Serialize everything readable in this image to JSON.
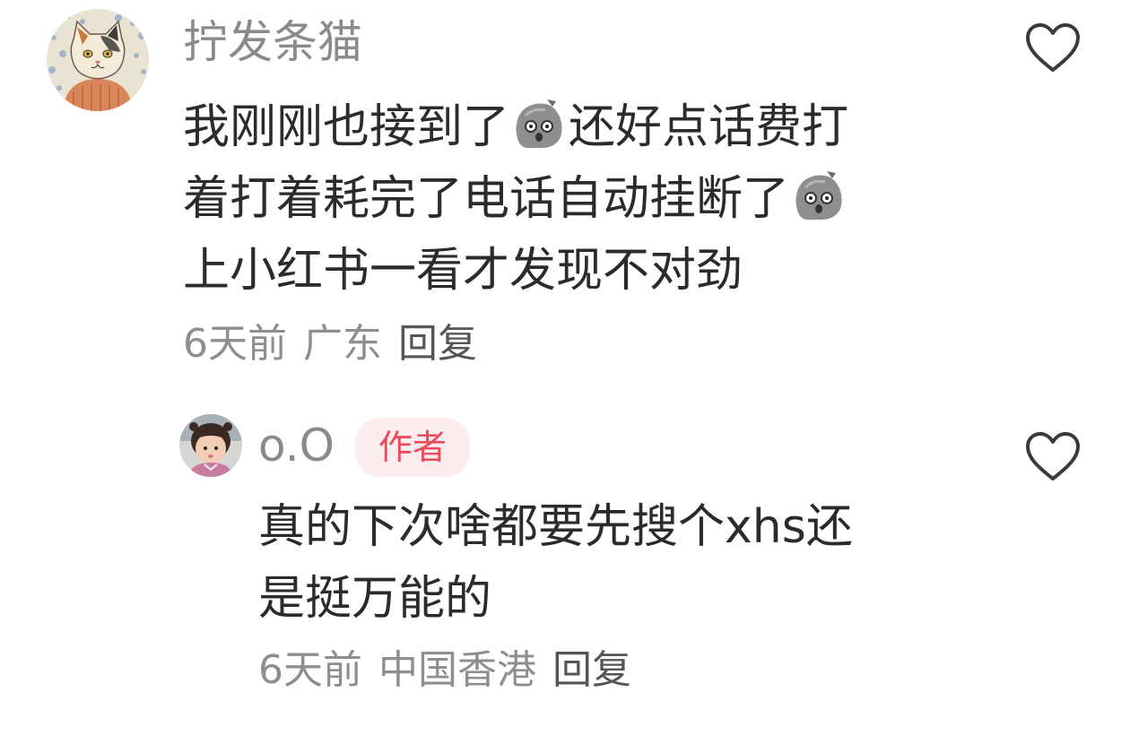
{
  "comments": [
    {
      "username": "拧发条猫",
      "lines": [
        [
          "我刚刚也接到了",
          "{emoji}",
          "还好点话费打"
        ],
        [
          "着打着耗完了电话自动挂断了",
          "{emoji}"
        ],
        [
          "上小红书一看才发现不对劲"
        ]
      ],
      "line1_a": "我刚刚也接到了",
      "line1_b": "还好点话费打",
      "line2_a": "着打着耗完了电话自动挂断了",
      "line3": "上小红书一看才发现不对劲",
      "time": "6天前",
      "location": "广东",
      "reply_label": "回复",
      "emoji_icon": "shocked-rock-emoji-icon"
    },
    {
      "username": "o.O",
      "badge": "作者",
      "line1": "真的下次啥都要先搜个xhs还",
      "line2": "是挺万能的",
      "time": "6天前",
      "location": "中国香港",
      "reply_label": "回复"
    }
  ],
  "colors": {
    "username": "#8a8a8a",
    "text": "#2b2b2b",
    "meta": "#8e8e8e",
    "badge_bg": "#fdecee",
    "badge_text": "#ea4a5a",
    "heart_stroke": "#3a3a3a"
  }
}
